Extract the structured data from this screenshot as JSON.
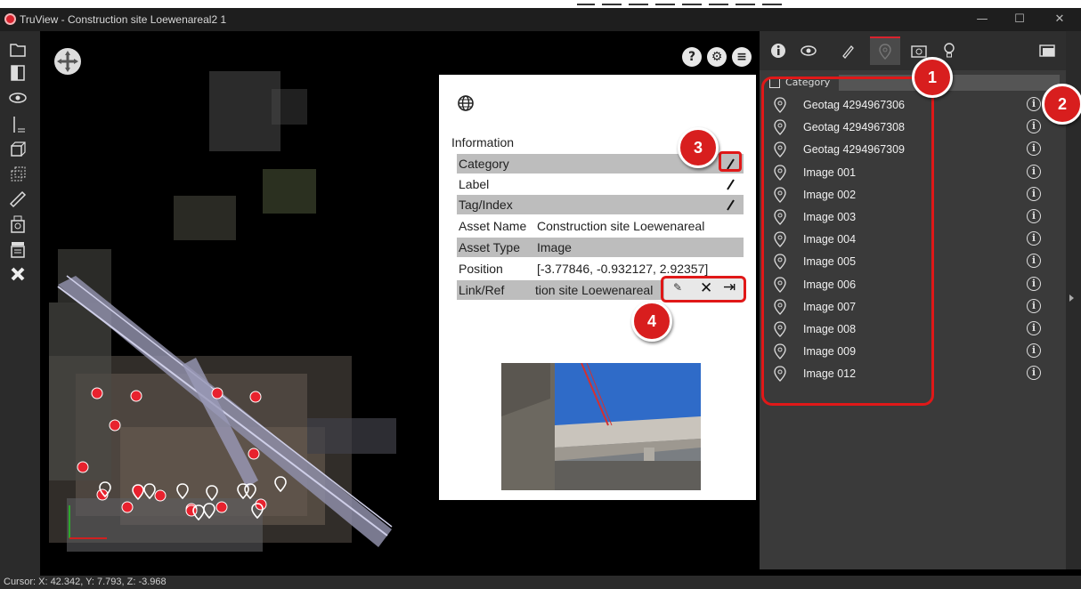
{
  "window": {
    "title": "TruView - Construction site Loewenareal2 1",
    "controls": [
      "—",
      "☐",
      "✕"
    ]
  },
  "left_toolbar": {
    "icons": [
      "folder-open-icon",
      "map-book-icon",
      "eye-icon",
      "measure-height-icon",
      "box-icon",
      "cube-icon",
      "ruler-icon",
      "camera-print-icon",
      "clapper-icon",
      "tools-icon"
    ]
  },
  "viewport": {
    "controls": {
      "help": "?",
      "settings": "⚙",
      "layers": "≡"
    }
  },
  "info_panel": {
    "heading": "Information",
    "rows": [
      {
        "label": "Category",
        "value": "",
        "editable": true
      },
      {
        "label": "Label",
        "value": "",
        "editable": true
      },
      {
        "label": "Tag/Index",
        "value": "",
        "editable": true
      },
      {
        "label": "Asset Name",
        "value": "Construction site Loewenareal",
        "editable": false
      },
      {
        "label": "Asset Type",
        "value": "Image",
        "editable": false
      },
      {
        "label": "Position",
        "value": "[-3.77846, -0.932127, 2.92357]",
        "editable": false
      },
      {
        "label": "Link/Ref",
        "value": "tion site Loewenareal",
        "editable": false
      }
    ],
    "link_tools": {
      "edit": "✎",
      "delete": "✕",
      "open": "⇥"
    }
  },
  "right_panel": {
    "tabs": [
      "info-tab",
      "visibility-tab",
      "markup-tab",
      "geotag-tab",
      "camera-tab",
      "lightbulb-tab"
    ],
    "active_tab": "geotag-tab",
    "category_label": "Category",
    "items": [
      {
        "name": "Geotag 4294967306"
      },
      {
        "name": "Geotag 4294967308"
      },
      {
        "name": "Geotag 4294967309"
      },
      {
        "name": "Image 001"
      },
      {
        "name": "Image 002"
      },
      {
        "name": "Image 003"
      },
      {
        "name": "Image 004"
      },
      {
        "name": "Image 005"
      },
      {
        "name": "Image 006"
      },
      {
        "name": "Image 007"
      },
      {
        "name": "Image 008"
      },
      {
        "name": "Image 009"
      },
      {
        "name": "Image 012"
      }
    ],
    "info_glyph": "i"
  },
  "status_bar": {
    "cursor": "Cursor: X: 42.342, Y: 7.793, Z: -3.968"
  },
  "callouts": [
    "1",
    "2",
    "3",
    "4"
  ],
  "colors": {
    "accent": "#d9232e",
    "callout": "#d81e1e",
    "panel": "#3a3a3a"
  }
}
